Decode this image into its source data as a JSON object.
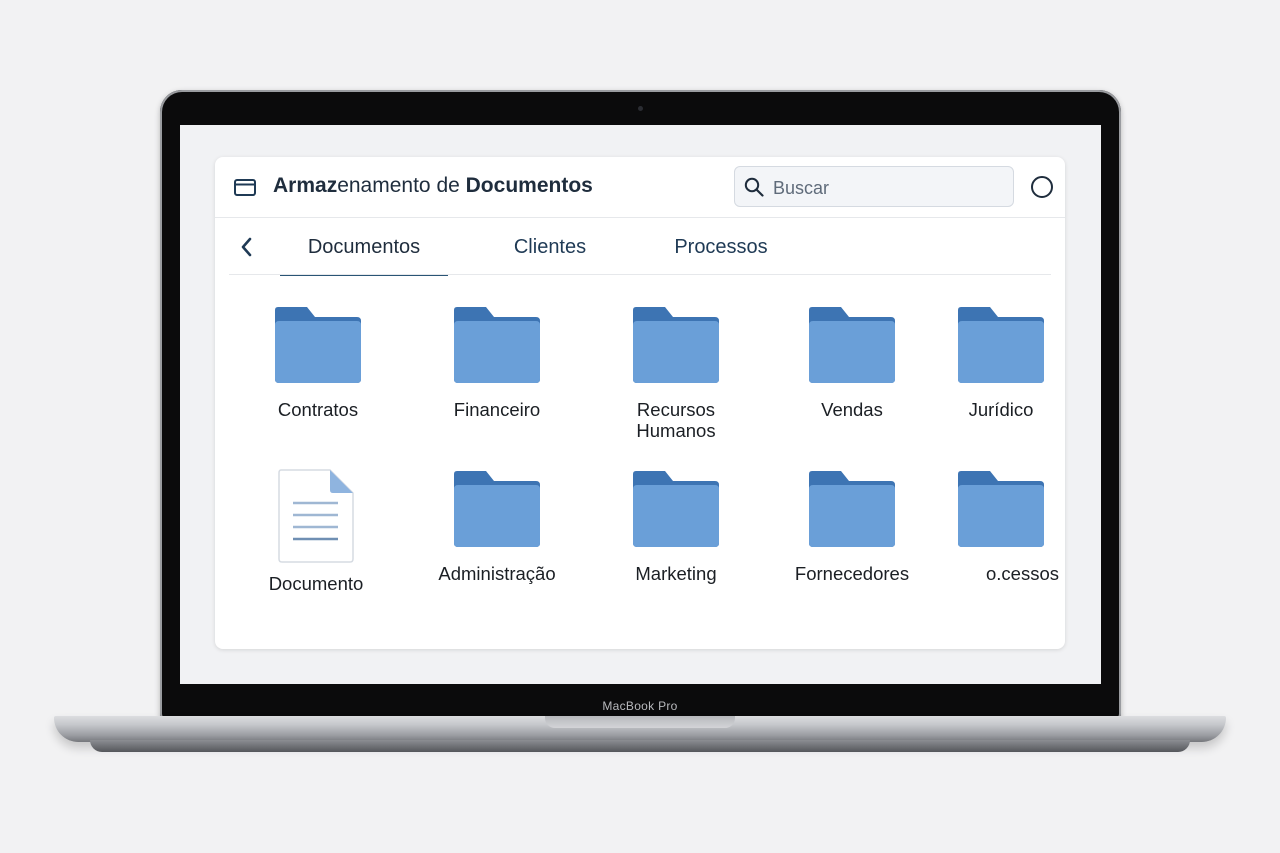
{
  "device": {
    "bezel_label": "MacBook Pro"
  },
  "app": {
    "title_bold_prefix": "Armaz",
    "title_mid": "enamento de ",
    "title_bold_suffix": "Documentos",
    "icon": "window-icon"
  },
  "search": {
    "placeholder": "Buscar",
    "value": "",
    "icon": "search-icon"
  },
  "tabs": [
    {
      "label": "Documentos",
      "active": true
    },
    {
      "label": "Clientes",
      "active": false
    },
    {
      "label": "Processos",
      "active": false
    }
  ],
  "items": [
    {
      "label": "Contratos",
      "type": "folder"
    },
    {
      "label": "Financeiro",
      "type": "folder"
    },
    {
      "label": "Recursos Humanos",
      "type": "folder"
    },
    {
      "label": "Vendas",
      "type": "folder"
    },
    {
      "label": "Jurídico",
      "type": "folder"
    },
    {
      "label": "Documento",
      "type": "document"
    },
    {
      "label": "Administração",
      "type": "folder"
    },
    {
      "label": "Marketing",
      "type": "folder"
    },
    {
      "label": "Fornecedores",
      "type": "folder"
    },
    {
      "label": "o.cessos",
      "type": "folder"
    }
  ],
  "colors": {
    "folder_body": "#6a9fd8",
    "folder_tab": "#3d74b3",
    "accent": "#2a5575",
    "text": "#1f2d3d"
  }
}
